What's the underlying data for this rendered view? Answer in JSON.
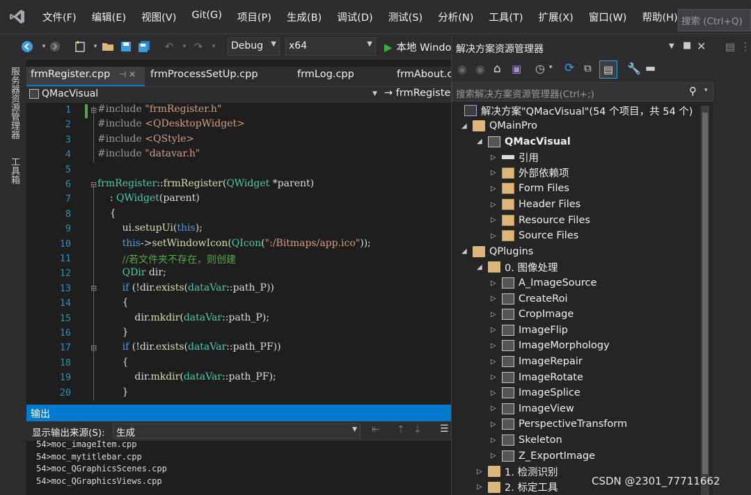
{
  "menubar": {
    "items": [
      "文件(F)",
      "编辑(E)",
      "视图(V)",
      "Git(G)",
      "项目(P)",
      "生成(B)",
      "调试(D)",
      "测试(S)",
      "分析(N)",
      "工具(T)",
      "扩展(X)",
      "窗口(W)",
      "帮助(H)"
    ],
    "search": "搜索 (Ctrl+Q)"
  },
  "toolbar": {
    "config": "Debug",
    "platform": "x64",
    "run_label": "本地 Windo"
  },
  "leftstrip": {
    "items": [
      "服务器资源管理器",
      "工具箱"
    ]
  },
  "tabs": [
    {
      "label": "frmRegister.cpp",
      "pin": "⊣ ✕"
    },
    {
      "label": "frmProcessSetUp.cpp"
    },
    {
      "label": "frmLog.cpp"
    },
    {
      "label": "frmAbout.c"
    }
  ],
  "navbar": {
    "scope": "QMacVisual",
    "member": "→ frmRegiste"
  },
  "editor": {
    "line_numbers": [
      "1",
      "2",
      "3",
      "4",
      "5",
      "6",
      "7",
      "8",
      "9",
      "10",
      "11",
      "12",
      "13",
      "14",
      "15",
      "16",
      "17",
      "18",
      "19",
      "20"
    ],
    "lines": [
      [
        {
          "t": "#include ",
          "c": "pp"
        },
        {
          "t": "\"frmRegister.h\"",
          "c": "str"
        }
      ],
      [
        {
          "t": "#include ",
          "c": "pp"
        },
        {
          "t": "<QDesktopWidget>",
          "c": "str"
        }
      ],
      [
        {
          "t": "#include ",
          "c": "pp"
        },
        {
          "t": "<QStyle>",
          "c": "str"
        }
      ],
      [
        {
          "t": "#include ",
          "c": "pp"
        },
        {
          "t": "\"datavar.h\"",
          "c": "str"
        }
      ],
      [],
      [
        {
          "t": "frmRegister",
          "c": "cls"
        },
        {
          "t": "::",
          "c": ""
        },
        {
          "t": "frmRegister",
          "c": "fn"
        },
        {
          "t": "(",
          "c": ""
        },
        {
          "t": "QWidget",
          "c": "cls"
        },
        {
          "t": " *parent)",
          "c": ""
        }
      ],
      [
        {
          "t": "    : ",
          "c": ""
        },
        {
          "t": "QWidget",
          "c": "cls"
        },
        {
          "t": "(parent)",
          "c": ""
        }
      ],
      [
        {
          "t": "    {",
          "c": ""
        }
      ],
      [
        {
          "t": "        ui.",
          "c": ""
        },
        {
          "t": "setupUi",
          "c": "fn"
        },
        {
          "t": "(",
          "c": ""
        },
        {
          "t": "this",
          "c": "kw"
        },
        {
          "t": ");",
          "c": ""
        }
      ],
      [
        {
          "t": "        ",
          "c": ""
        },
        {
          "t": "this",
          "c": "kw"
        },
        {
          "t": "->",
          "c": ""
        },
        {
          "t": "setWindowIcon",
          "c": "fn"
        },
        {
          "t": "(",
          "c": ""
        },
        {
          "t": "QIcon",
          "c": "cls"
        },
        {
          "t": "(",
          "c": ""
        },
        {
          "t": "\":/Bitmaps/app.ico\"",
          "c": "str"
        },
        {
          "t": "));",
          "c": ""
        }
      ],
      [
        {
          "t": "        ",
          "c": ""
        },
        {
          "t": "//若文件夹不存在，则创建",
          "c": "cm"
        }
      ],
      [
        {
          "t": "        ",
          "c": ""
        },
        {
          "t": "QDir",
          "c": "cls"
        },
        {
          "t": " dir;",
          "c": ""
        }
      ],
      [
        {
          "t": "        ",
          "c": ""
        },
        {
          "t": "if",
          "c": "kw"
        },
        {
          "t": " (!dir.",
          "c": ""
        },
        {
          "t": "exists",
          "c": "fn"
        },
        {
          "t": "(",
          "c": ""
        },
        {
          "t": "dataVar",
          "c": "cls"
        },
        {
          "t": "::path_P))",
          "c": ""
        }
      ],
      [
        {
          "t": "        {",
          "c": ""
        }
      ],
      [
        {
          "t": "            dir.",
          "c": ""
        },
        {
          "t": "mkdir",
          "c": "fn"
        },
        {
          "t": "(",
          "c": ""
        },
        {
          "t": "dataVar",
          "c": "cls"
        },
        {
          "t": "::path_P);",
          "c": ""
        }
      ],
      [
        {
          "t": "        }",
          "c": ""
        }
      ],
      [
        {
          "t": "        ",
          "c": ""
        },
        {
          "t": "if",
          "c": "kw"
        },
        {
          "t": " (!dir.",
          "c": ""
        },
        {
          "t": "exists",
          "c": "fn"
        },
        {
          "t": "(",
          "c": ""
        },
        {
          "t": "dataVar",
          "c": "cls"
        },
        {
          "t": "::path_PF))",
          "c": ""
        }
      ],
      [
        {
          "t": "        {",
          "c": ""
        }
      ],
      [
        {
          "t": "            dir.",
          "c": ""
        },
        {
          "t": "mkdir",
          "c": "fn"
        },
        {
          "t": "(",
          "c": ""
        },
        {
          "t": "dataVar",
          "c": "cls"
        },
        {
          "t": "::path_PF);",
          "c": ""
        }
      ],
      [
        {
          "t": "        }",
          "c": ""
        }
      ]
    ]
  },
  "output": {
    "title": "输出",
    "source_label": "显示输出来源(S):",
    "source_value": "生成",
    "lines": [
      "54>moc_imageItem.cpp",
      "54>moc_mytitlebar.cpp",
      "54>moc_QGraphicsScenes.cpp",
      "54>moc_QGraphicsViews.cpp"
    ]
  },
  "solution_explorer": {
    "title": "解决方案资源管理器",
    "search_placeholder": "搜索解决方案资源管理器(Ctrl+;)",
    "solution": "解决方案\"QMacVisual\"(54 个项目，共 54 个)",
    "items": [
      {
        "label": "QMainPro",
        "level": 0,
        "kind": "folder",
        "tw": "◢"
      },
      {
        "label": "QMacVisual",
        "level": 1,
        "kind": "proj",
        "tw": "◢",
        "bold": true
      },
      {
        "label": "引用",
        "level": 2,
        "kind": "ref",
        "tw": "▷"
      },
      {
        "label": "外部依赖项",
        "level": 2,
        "kind": "filt",
        "tw": "▷"
      },
      {
        "label": "Form Files",
        "level": 2,
        "kind": "filt",
        "tw": "▷"
      },
      {
        "label": "Header Files",
        "level": 2,
        "kind": "filt",
        "tw": "▷"
      },
      {
        "label": "Resource Files",
        "level": 2,
        "kind": "filt",
        "tw": "▷"
      },
      {
        "label": "Source Files",
        "level": 2,
        "kind": "filt",
        "tw": "▷"
      },
      {
        "label": "QPlugins",
        "level": 0,
        "kind": "folder",
        "tw": "◢"
      },
      {
        "label": "0. 图像处理",
        "level": 1,
        "kind": "folder",
        "tw": "◢"
      },
      {
        "label": "A_ImageSource",
        "level": 2,
        "kind": "proj",
        "tw": "▷"
      },
      {
        "label": "CreateRoi",
        "level": 2,
        "kind": "proj",
        "tw": "▷"
      },
      {
        "label": "CropImage",
        "level": 2,
        "kind": "proj",
        "tw": "▷"
      },
      {
        "label": "ImageFlip",
        "level": 2,
        "kind": "proj",
        "tw": "▷"
      },
      {
        "label": "ImageMorphology",
        "level": 2,
        "kind": "proj",
        "tw": "▷"
      },
      {
        "label": "ImageRepair",
        "level": 2,
        "kind": "proj",
        "tw": "▷"
      },
      {
        "label": "ImageRotate",
        "level": 2,
        "kind": "proj",
        "tw": "▷"
      },
      {
        "label": "ImageSplice",
        "level": 2,
        "kind": "proj",
        "tw": "▷"
      },
      {
        "label": "ImageView",
        "level": 2,
        "kind": "proj",
        "tw": "▷"
      },
      {
        "label": "PerspectiveTransform",
        "level": 2,
        "kind": "proj",
        "tw": "▷"
      },
      {
        "label": "Skeleton",
        "level": 2,
        "kind": "proj",
        "tw": "▷"
      },
      {
        "label": "Z_ExportImage",
        "level": 2,
        "kind": "proj",
        "tw": "▷"
      },
      {
        "label": "1. 检测识别",
        "level": 1,
        "kind": "folder",
        "tw": "▷"
      },
      {
        "label": "2. 标定工具",
        "level": 1,
        "kind": "folder",
        "tw": "▷"
      }
    ]
  },
  "watermark": "CSDN @2301_77711662"
}
